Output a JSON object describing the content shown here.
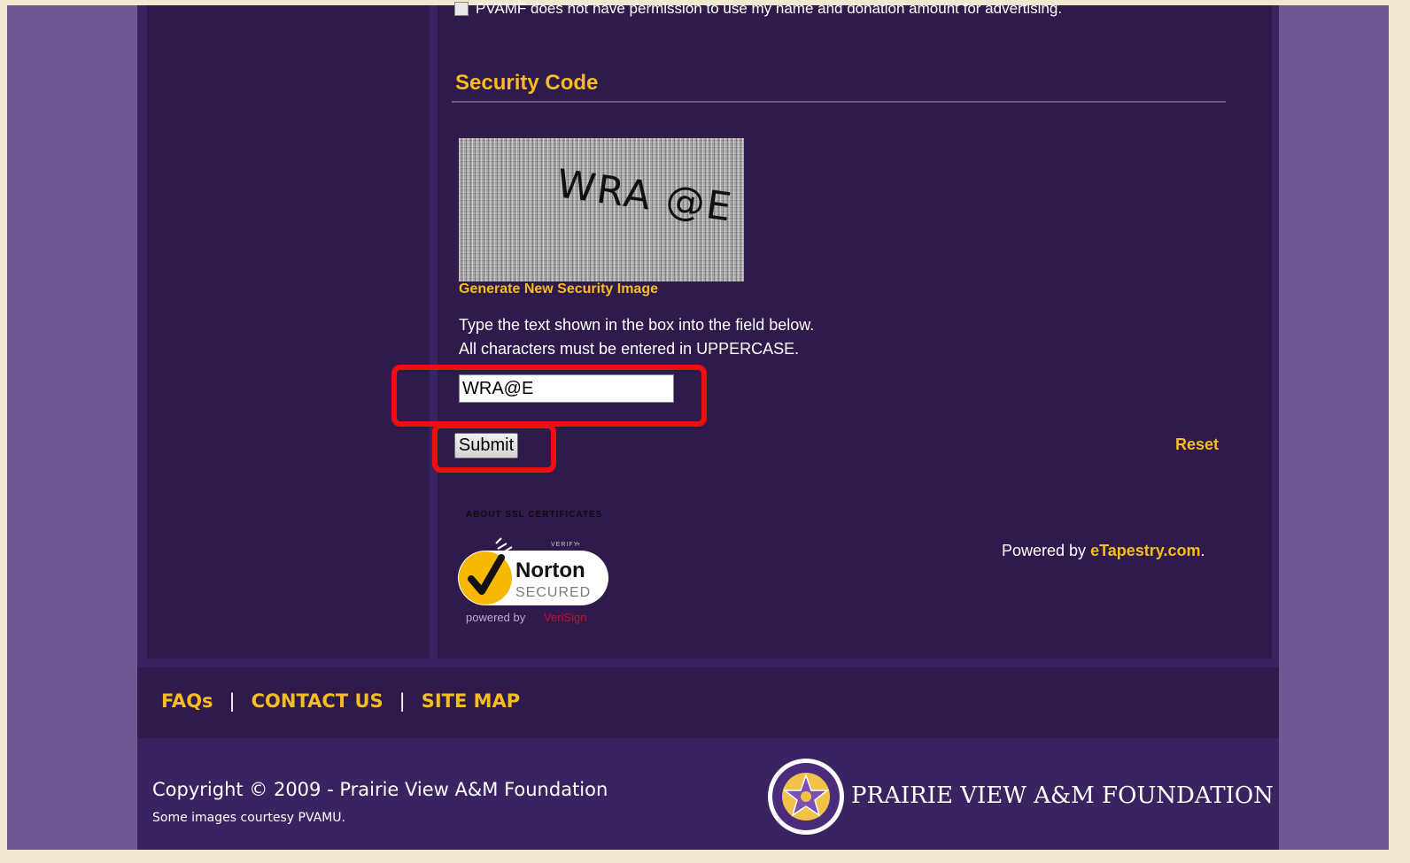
{
  "form": {
    "permission_text": "PVAMF does not have permission to use my name and donation amount for advertising."
  },
  "security": {
    "heading": "Security Code",
    "captcha_text": "WRA @E",
    "generate_link": "Generate New Security Image",
    "instruction_line1": "Type the text shown in the box into the field below.",
    "instruction_line2": "All characters must be entered in UPPERCASE.",
    "input_value": "WRA@E",
    "submit_label": "Submit",
    "reset_label": "Reset"
  },
  "ssl": {
    "caption": "ABOUT SSL CERTIFICATES",
    "badge_verify": "VERIFY",
    "badge_brand": "Norton",
    "badge_secured": "SECURED",
    "badge_powered": "powered by",
    "badge_powered_brand": "VeriSign"
  },
  "powered_by": {
    "prefix": "Powered by",
    "link": "eTapestry.com",
    "suffix": "."
  },
  "footer": {
    "links": [
      "FAQs",
      "CONTACT US",
      "SITE MAP"
    ],
    "separator": "|",
    "copyright": "Copyright © 2009 - Prairie View A&M Foundation",
    "courtesy": "Some images courtesy PVAMU.",
    "foundation_name": "PRAIRIE VIEW A&M FOUNDATION"
  },
  "colors": {
    "accent": "#f6bd1f",
    "panel": "#2f1a4b",
    "page": "#3a2361",
    "outer": "#6f5792",
    "highlight": "#f10e0e"
  }
}
